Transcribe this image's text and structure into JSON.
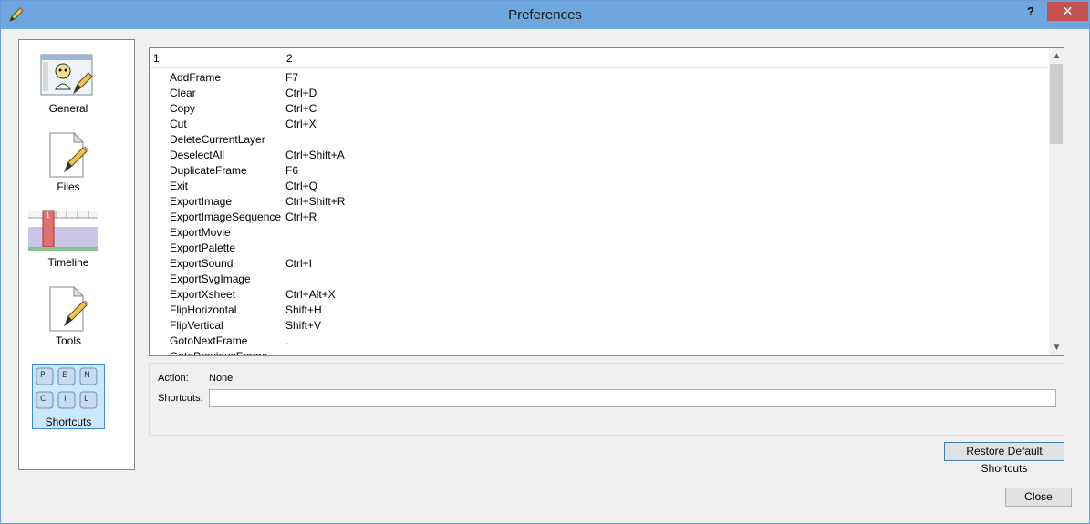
{
  "window": {
    "title": "Preferences",
    "help_label": "?",
    "close_label": "✕"
  },
  "categories": [
    {
      "label": "General",
      "icon": "general-icon"
    },
    {
      "label": "Files",
      "icon": "files-icon"
    },
    {
      "label": "Timeline",
      "icon": "timeline-icon"
    },
    {
      "label": "Tools",
      "icon": "tools-icon"
    },
    {
      "label": "Shortcuts",
      "icon": "shortcuts-icon",
      "selected": true
    }
  ],
  "table": {
    "headers": [
      "1",
      "2"
    ],
    "rows": [
      {
        "action": "AddFrame",
        "key": "F7"
      },
      {
        "action": "Clear",
        "key": "Ctrl+D"
      },
      {
        "action": "Copy",
        "key": "Ctrl+C"
      },
      {
        "action": "Cut",
        "key": "Ctrl+X"
      },
      {
        "action": "DeleteCurrentLayer",
        "key": ""
      },
      {
        "action": "DeselectAll",
        "key": "Ctrl+Shift+A"
      },
      {
        "action": "DuplicateFrame",
        "key": "F6"
      },
      {
        "action": "Exit",
        "key": "Ctrl+Q"
      },
      {
        "action": "ExportImage",
        "key": "Ctrl+Shift+R"
      },
      {
        "action": "ExportImageSequence",
        "key": "Ctrl+R"
      },
      {
        "action": "ExportMovie",
        "key": ""
      },
      {
        "action": "ExportPalette",
        "key": ""
      },
      {
        "action": "ExportSound",
        "key": "Ctrl+I"
      },
      {
        "action": "ExportSvgImage",
        "key": ""
      },
      {
        "action": "ExportXsheet",
        "key": "Ctrl+Alt+X"
      },
      {
        "action": "FlipHorizontal",
        "key": "Shift+H"
      },
      {
        "action": "FlipVertical",
        "key": "Shift+V"
      },
      {
        "action": "GotoNextFrame",
        "key": "."
      },
      {
        "action": "GotoPreviousFrame",
        "key": ""
      }
    ]
  },
  "details": {
    "action_label": "Action:",
    "action_value": "None",
    "shortcuts_label": "Shortcuts:",
    "shortcuts_value": ""
  },
  "buttons": {
    "restore": "Restore Default Shortcuts",
    "close": "Close"
  },
  "colors": {
    "titlebar": "#6ea6de",
    "selection": "#cce8ff",
    "close_button": "#c75050"
  }
}
